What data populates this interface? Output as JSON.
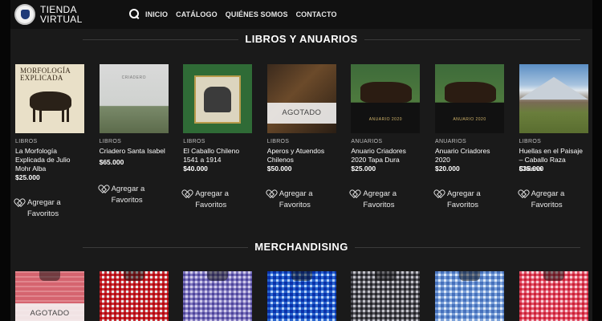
{
  "header": {
    "logo_line1": "TIENDA",
    "logo_line2": "VIRTUAL",
    "nav": [
      "INICIO",
      "CATÁLOGO",
      "QUIÉNES SOMOS",
      "CONTACTO"
    ]
  },
  "sections": {
    "books_title": "LIBROS Y ANUARIOS",
    "merch_title": "MERCHANDISING"
  },
  "books": [
    {
      "category": "LIBROS",
      "name": "La Morfología Explicada de Julio Mohr Alba",
      "price": "$25.000",
      "fav": "Agregar a Favoritos",
      "cover_title": "MORFOLOGÍA EXPLICADA"
    },
    {
      "category": "LIBROS",
      "name": "Criadero Santa Isabel",
      "price": "$65.000",
      "fav": "Agregar a Favoritos",
      "cover_title": "CRIADERO"
    },
    {
      "category": "LIBROS",
      "name": "El Caballo Chileno 1541 a 1914",
      "price": "$40.000",
      "fav": "Agregar a Favoritos"
    },
    {
      "category": "LIBROS",
      "name": "Aperos y Atuendos Chilenos",
      "price": "$50.000",
      "fav": "Agregar a Favoritos",
      "badge": "AGOTADO"
    },
    {
      "category": "ANUARIOS",
      "name": "Anuario Criadores 2020 Tapa Dura",
      "price": "$25.000",
      "fav": "Agregar a Favoritos",
      "cover_title": "ANUARIO 2020"
    },
    {
      "category": "ANUARIOS",
      "name": "Anuario Criadores 2020",
      "price": "$20.000",
      "fav": "Agregar a Favoritos",
      "cover_title": "ANUARIO 2020"
    },
    {
      "category": "LIBROS",
      "name": "Huellas en el Paisaje – Caballo Raza Chilena",
      "price": "$35.000",
      "fav": "Agregar a Favoritos"
    }
  ],
  "merch": [
    {
      "style": "sh-red",
      "badge": "AGOTADO"
    },
    {
      "style": "sh-red2"
    },
    {
      "style": "sh-lav"
    },
    {
      "style": "sh-blue"
    },
    {
      "style": "sh-grey"
    },
    {
      "style": "sh-lblue"
    },
    {
      "style": "sh-pink"
    }
  ]
}
